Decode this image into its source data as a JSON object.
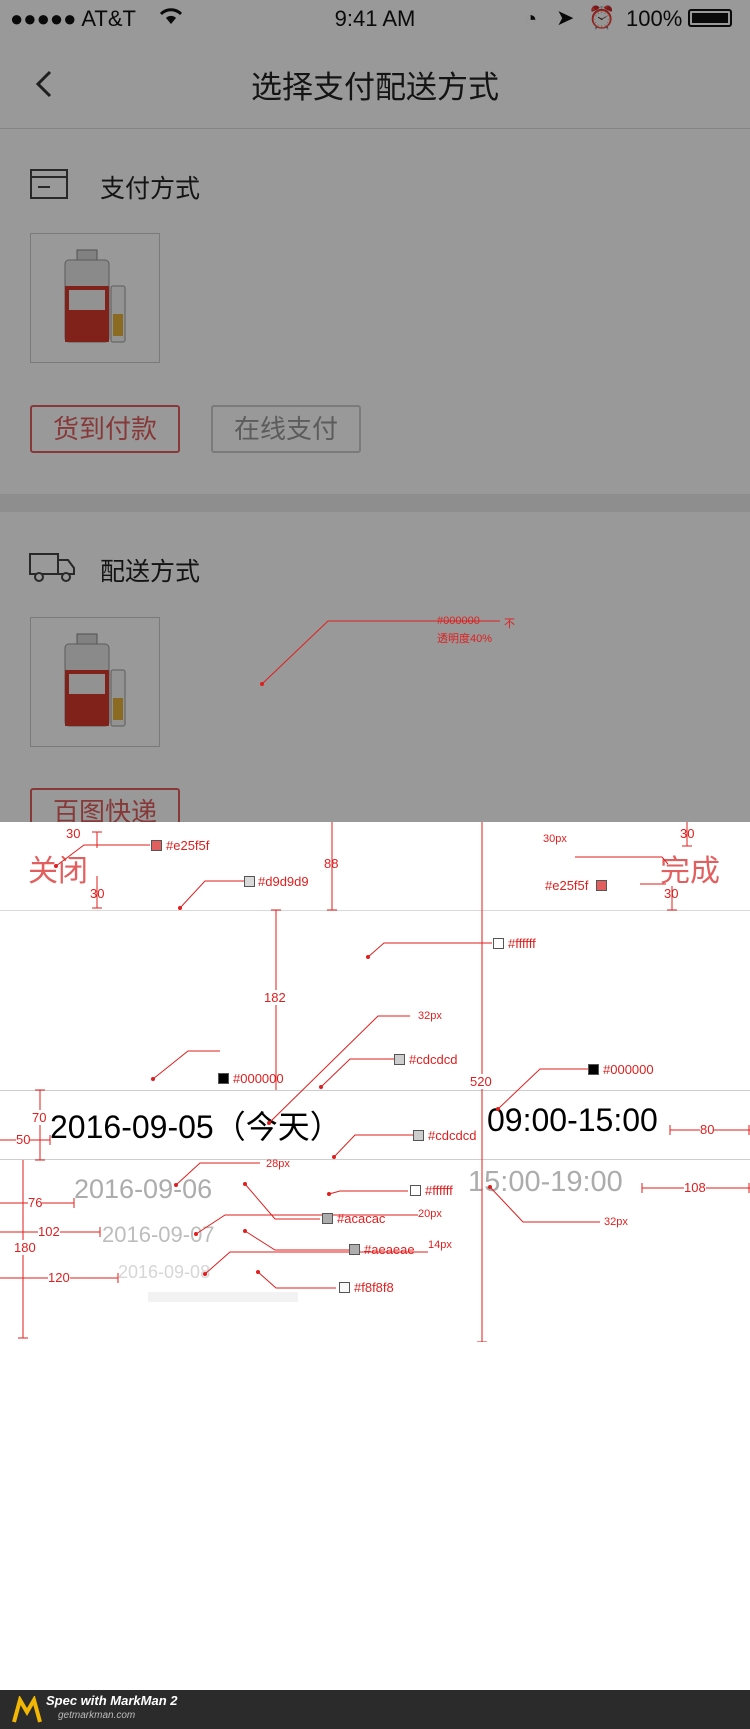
{
  "status_bar": {
    "carrier": "●●●●● AT&T",
    "time": "9:41 AM",
    "battery": "100%"
  },
  "nav": {
    "title": "选择支付配送方式"
  },
  "payment": {
    "title": "支付方式",
    "options": [
      {
        "label": "货到付款",
        "selected": true
      },
      {
        "label": "在线支付",
        "selected": false
      }
    ]
  },
  "delivery": {
    "title": "配送方式",
    "options": [
      {
        "label": "百图快递",
        "selected": true
      }
    ]
  },
  "overlay_note": {
    "color": "#000000",
    "text1": "不",
    "text2": "透明度40%"
  },
  "picker": {
    "close_label": "关闭",
    "done_label": "完成",
    "dates": [
      "2016-09-05（今天）",
      "2016-09-06",
      "2016-09-07",
      "2016-09-08"
    ],
    "times": [
      "09:00-15:00",
      "15:00-19:00"
    ]
  },
  "spec": {
    "dims": {
      "close_top": "30",
      "close_bottom": "30",
      "header_h": "88",
      "done_top_px": "30px",
      "done_top": "30",
      "done_bottom": "30",
      "row_offset": "182",
      "divider_x": "520",
      "sel_h": "70",
      "left_50": "50",
      "right_80": "80",
      "left_76": "76",
      "right_108": "108",
      "left_102": "102",
      "left_120": "120",
      "wheel_h": "180"
    },
    "colors": {
      "close": "#e25f5f",
      "header_line": "#d9d9d9",
      "bg_white": "#ffffff",
      "sel_line_top": "#cdcdcd",
      "sel_text_left": "#000000",
      "sel_text_right": "#000000",
      "sel_line_bottom": "#cdcdcd",
      "row2_bg": "#ffffff",
      "row2_text": "#acacac",
      "row3_text": "#aeaeae",
      "row4_text": "#f8f8f8",
      "done": "#e25f5f"
    },
    "sizes": {
      "sel_font": "32px",
      "right_font": "32px",
      "row2_font": "28px",
      "row3_font": "20px",
      "row4_font": "14px"
    }
  },
  "footer": {
    "brand": "Spec with MarkMan 2",
    "site": "getmarkman.com"
  }
}
